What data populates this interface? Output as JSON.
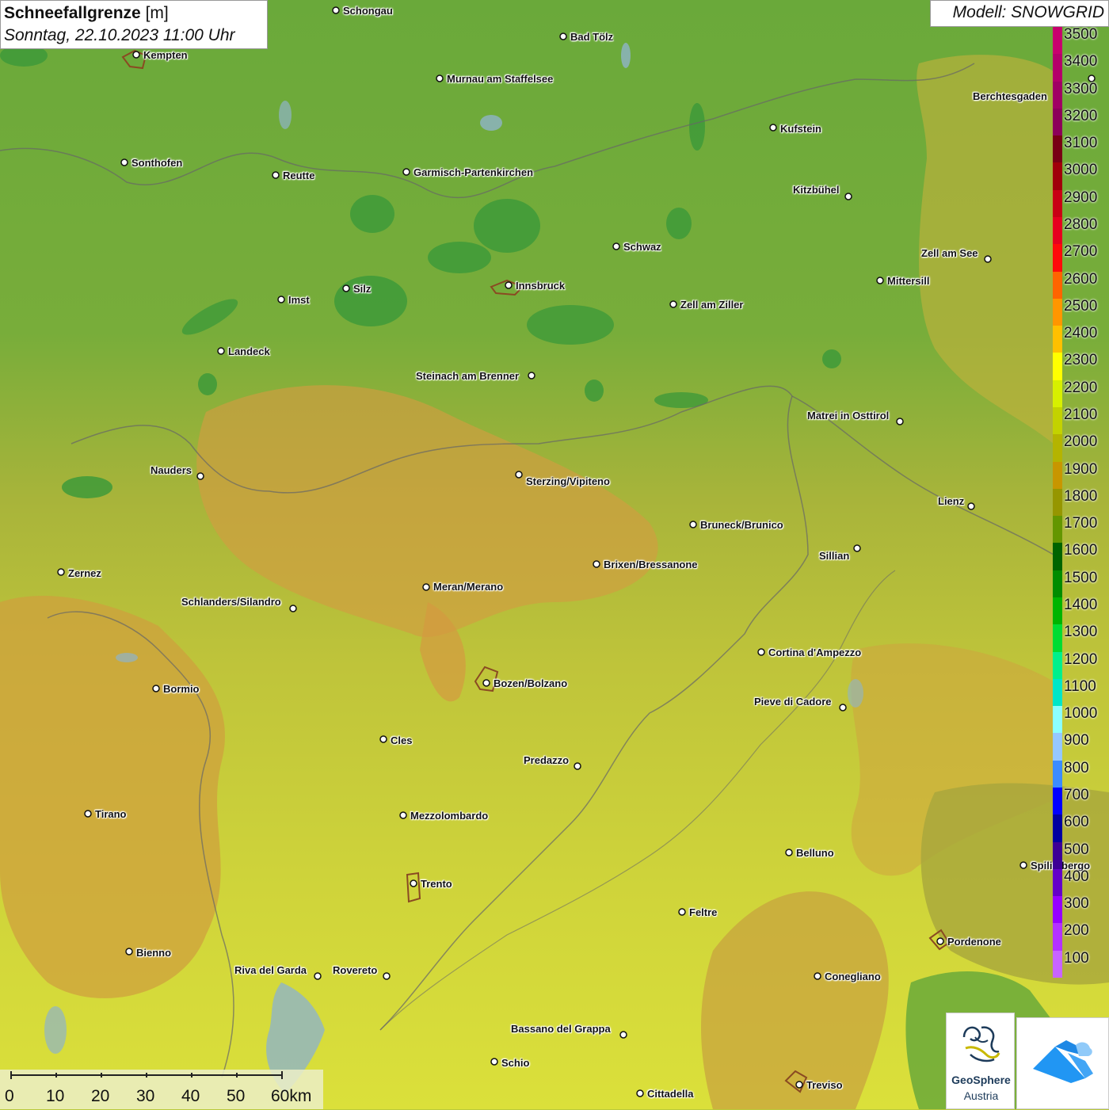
{
  "title": {
    "variable": "Schneefallgrenze",
    "unit": "[m]",
    "datetime": "Sonntag, 22.10.2023 11:00 Uhr"
  },
  "model": "Modell: SNOWGRID",
  "colors": {
    "lowland_green": "#6aa93a",
    "dark_green": "#3e9a3a",
    "olive": "#9fb33a",
    "orange": "#d09a3a",
    "yellow_green": "#c9d43a",
    "yellow": "#dfe33a"
  },
  "legend": {
    "items": [
      {
        "label": "3500",
        "color": "#c8006e"
      },
      {
        "label": "3400",
        "color": "#b4006a"
      },
      {
        "label": "3300",
        "color": "#a00064"
      },
      {
        "label": "3200",
        "color": "#8c005a"
      },
      {
        "label": "3100",
        "color": "#780014"
      },
      {
        "label": "3000",
        "color": "#a0000a"
      },
      {
        "label": "2900",
        "color": "#c80014"
      },
      {
        "label": "2800",
        "color": "#e6001e"
      },
      {
        "label": "2700",
        "color": "#ff0a0a"
      },
      {
        "label": "2600",
        "color": "#ff6400"
      },
      {
        "label": "2500",
        "color": "#ff9600"
      },
      {
        "label": "2400",
        "color": "#ffc000"
      },
      {
        "label": "2300",
        "color": "#ffff00"
      },
      {
        "label": "2200",
        "color": "#d7f000"
      },
      {
        "label": "2100",
        "color": "#c3d200"
      },
      {
        "label": "2000",
        "color": "#b4b400"
      },
      {
        "label": "1900",
        "color": "#c89600"
      },
      {
        "label": "1800",
        "color": "#969600"
      },
      {
        "label": "1700",
        "color": "#649600"
      },
      {
        "label": "1600",
        "color": "#006400"
      },
      {
        "label": "1500",
        "color": "#008c00"
      },
      {
        "label": "1400",
        "color": "#00b400"
      },
      {
        "label": "1300",
        "color": "#00dc32"
      },
      {
        "label": "1200",
        "color": "#00f08c"
      },
      {
        "label": "1100",
        "color": "#00e6c8"
      },
      {
        "label": "1000",
        "color": "#8cffff"
      },
      {
        "label": "900",
        "color": "#96c8ff"
      },
      {
        "label": "800",
        "color": "#3c8cff"
      },
      {
        "label": "700",
        "color": "#0000ff"
      },
      {
        "label": "600",
        "color": "#0000a0"
      },
      {
        "label": "500",
        "color": "#3c0096"
      },
      {
        "label": "400",
        "color": "#6400c8"
      },
      {
        "label": "300",
        "color": "#9600ff"
      },
      {
        "label": "200",
        "color": "#b432ff"
      },
      {
        "label": "100",
        "color": "#c864ff"
      }
    ]
  },
  "scalebar": {
    "ticks": [
      "0",
      "10",
      "20",
      "30",
      "40",
      "50",
      "60km"
    ]
  },
  "logo": {
    "name": "GeoSphere",
    "sub": "Austria",
    "icon": "geosphere-logo-icon",
    "app_icon": "app-mountain-icon"
  },
  "cities": [
    {
      "name": "Schongau"
    },
    {
      "name": "Bad Tölz"
    },
    {
      "name": "Kempten"
    },
    {
      "name": "Murnau am Staffelsee"
    },
    {
      "name": "Berchtesgaden"
    },
    {
      "name": "Kufstein"
    },
    {
      "name": "Sonthofen"
    },
    {
      "name": "Reutte"
    },
    {
      "name": "Garmisch-Partenkirchen"
    },
    {
      "name": "Kitzbühel"
    },
    {
      "name": "Schwaz"
    },
    {
      "name": "Zell am See"
    },
    {
      "name": "Mittersill"
    },
    {
      "name": "Innsbruck"
    },
    {
      "name": "Imst"
    },
    {
      "name": "Silz"
    },
    {
      "name": "Zell am Ziller"
    },
    {
      "name": "Landeck"
    },
    {
      "name": "Steinach am Brenner"
    },
    {
      "name": "Matrei in Osttirol"
    },
    {
      "name": "Nauders"
    },
    {
      "name": "Sterzing/Vipiteno"
    },
    {
      "name": "Lienz"
    },
    {
      "name": "Bruneck/Brunico"
    },
    {
      "name": "Sillian"
    },
    {
      "name": "Zernez"
    },
    {
      "name": "Brixen/Bressanone"
    },
    {
      "name": "Meran/Merano"
    },
    {
      "name": "Schlanders/Silandro"
    },
    {
      "name": "Cortina d'Ampezzo"
    },
    {
      "name": "Bormio"
    },
    {
      "name": "Bozen/Bolzano"
    },
    {
      "name": "Pieve di Cadore"
    },
    {
      "name": "Cles"
    },
    {
      "name": "Predazzo"
    },
    {
      "name": "Tirano"
    },
    {
      "name": "Mezzolombardo"
    },
    {
      "name": "Belluno"
    },
    {
      "name": "Spilimbergo"
    },
    {
      "name": "Trento"
    },
    {
      "name": "Feltre"
    },
    {
      "name": "Pordenone"
    },
    {
      "name": "Bienno"
    },
    {
      "name": "Riva del Garda"
    },
    {
      "name": "Rovereto"
    },
    {
      "name": "Conegliano"
    },
    {
      "name": "Bassano del Grappa"
    },
    {
      "name": "Schio"
    },
    {
      "name": "Treviso"
    },
    {
      "name": "Cittadella"
    }
  ]
}
